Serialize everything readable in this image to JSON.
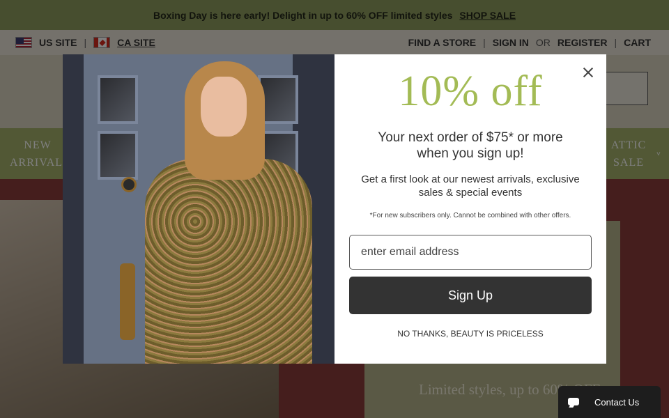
{
  "announcement": {
    "text": "Boxing Day is here early! Delight in up to 60% OFF limited styles",
    "cta": "SHOP SALE"
  },
  "utility": {
    "us_site": "US SITE",
    "ca_site": "CA SITE",
    "separator": "|",
    "find_store": "FIND A STORE",
    "sign_in": "SIGN IN",
    "or": "OR",
    "register": "REGISTER",
    "cart": "CART"
  },
  "nav": {
    "new_arrivals_line1": "NEW",
    "new_arrivals_line2": "ARRIVALS",
    "attic_line1": "ATTIC",
    "attic_line2": "SALE",
    "chevron": "˅"
  },
  "hero": {
    "text": "Limited styles, up to 60% OFF"
  },
  "modal": {
    "offer": "10% off",
    "sub1": "Your next order of $75* or more when you sign up!",
    "sub2": "Get a first look at our newest arrivals, exclusive sales & special events",
    "fine_print": "*For new subscribers only. Cannot be combined with other offers.",
    "email_placeholder": "enter email address",
    "signup_label": "Sign Up",
    "no_thanks": "NO THANKS, BEAUTY IS PRICELESS"
  },
  "chat": {
    "label": "Contact Us"
  },
  "colors": {
    "accent_green": "#a3bb55",
    "nav_green": "#a4b16b",
    "button_dark": "#333333"
  }
}
